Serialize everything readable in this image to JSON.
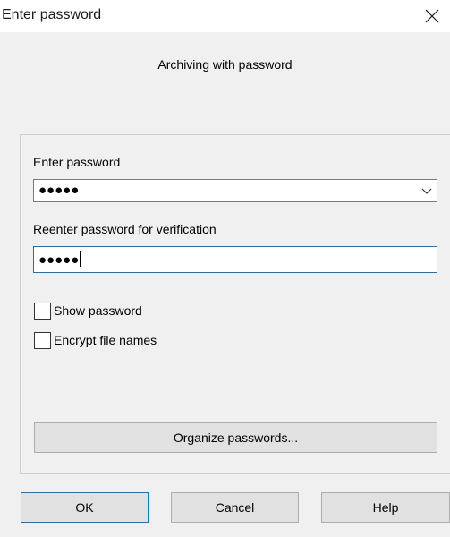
{
  "window": {
    "title": "Enter password",
    "close_icon": "close-icon"
  },
  "header": {
    "subtitle": "Archiving with password"
  },
  "form": {
    "password_label": "Enter password",
    "password_value": "●●●●●",
    "reenter_label": "Reenter password for verification",
    "reenter_value": "●●●●●",
    "show_password_label": "Show password",
    "show_password_checked": false,
    "encrypt_names_label": "Encrypt file names",
    "encrypt_names_checked": false,
    "organize_label": "Organize passwords..."
  },
  "buttons": {
    "ok": "OK",
    "cancel": "Cancel",
    "help": "Help"
  },
  "colors": {
    "focus_border": "#0078d7",
    "button_face": "#e1e1e1"
  }
}
